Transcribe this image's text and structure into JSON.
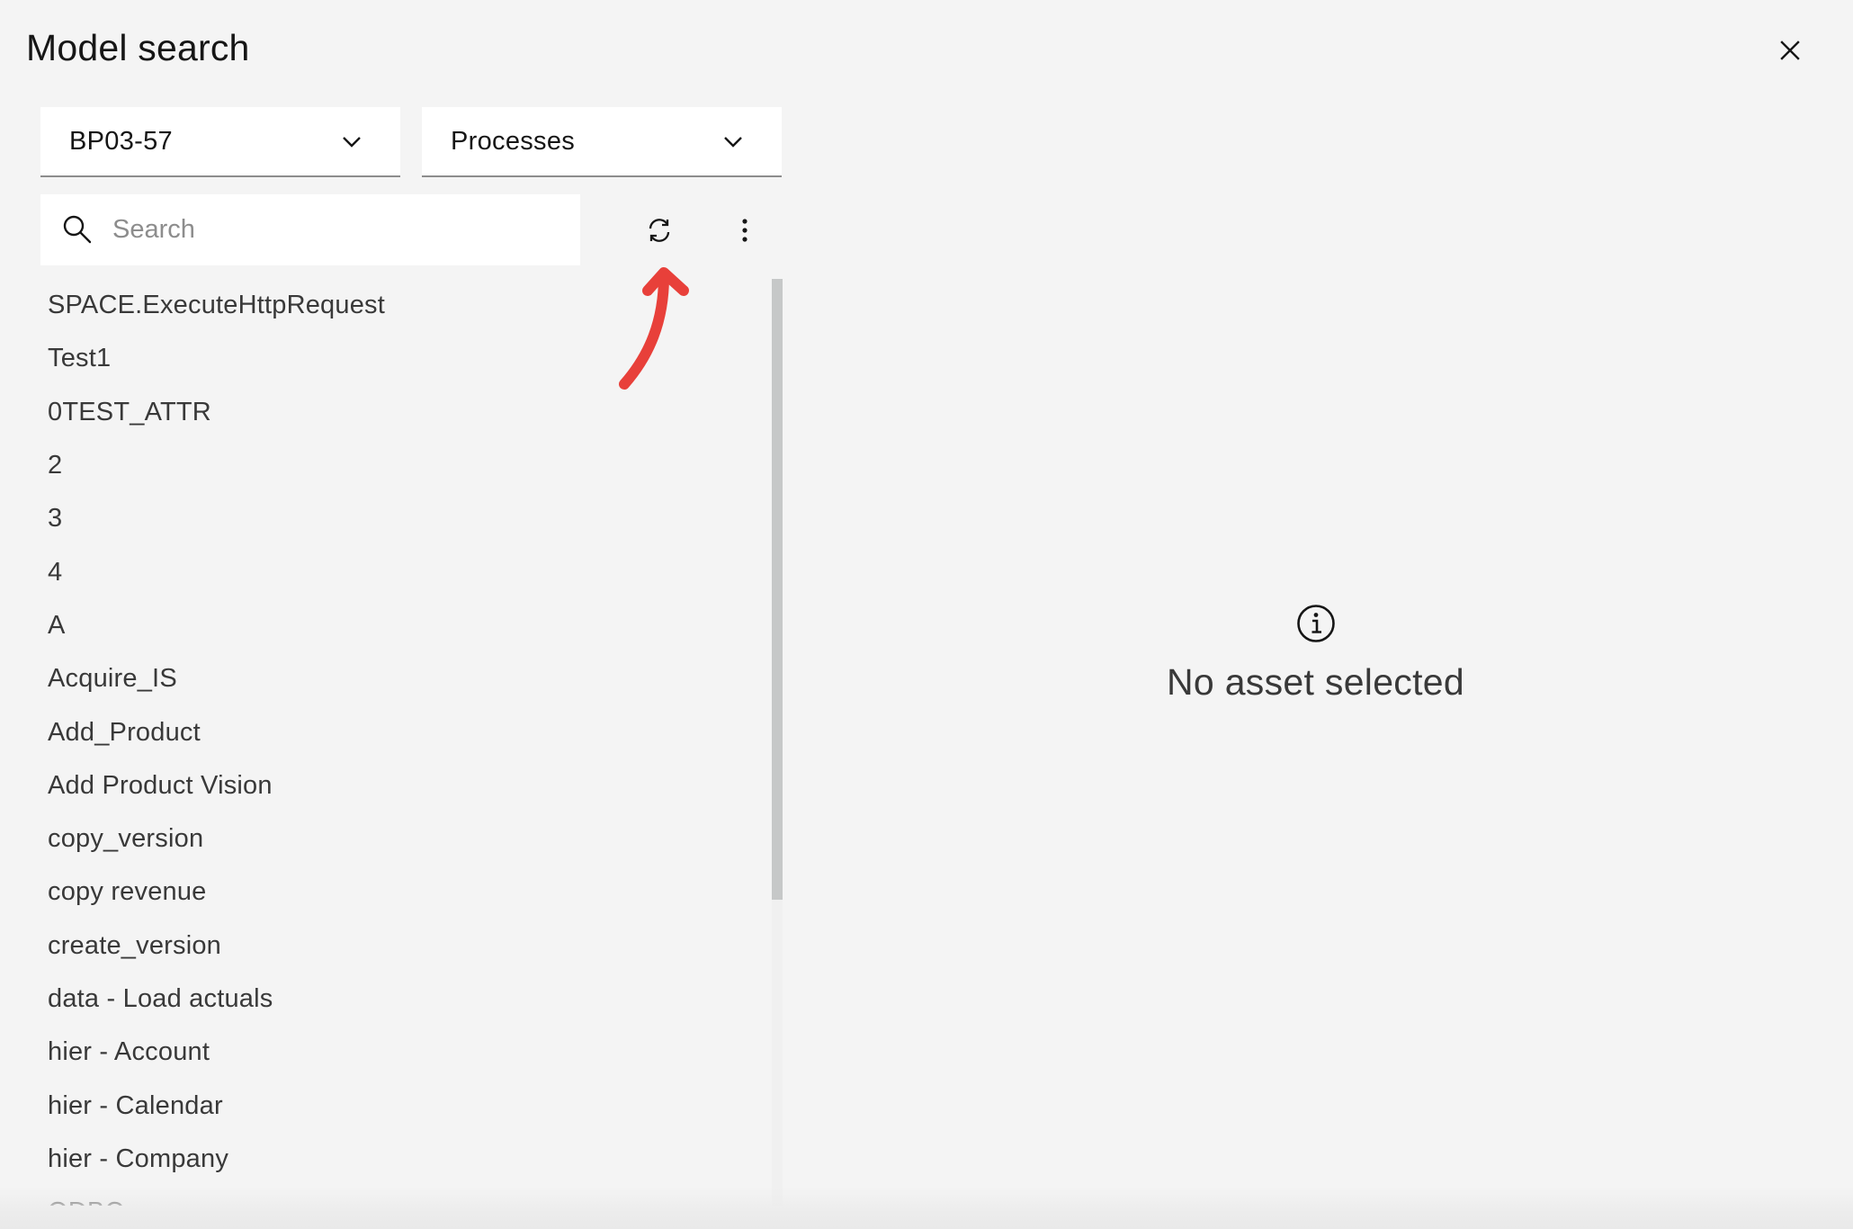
{
  "modal": {
    "title": "Model search",
    "close_icon": "close-icon"
  },
  "filters": {
    "model_dropdown": {
      "selected": "BP03-57",
      "icon": "chevron-down-icon"
    },
    "type_dropdown": {
      "selected": "Processes",
      "icon": "chevron-down-icon"
    }
  },
  "search": {
    "placeholder": "Search",
    "value": "",
    "icon": "search-icon"
  },
  "toolbar": {
    "refresh_icon": "refresh-icon",
    "overflow_icon": "overflow-menu-vertical-icon"
  },
  "annotation": {
    "arrow_color": "#e8403a",
    "icon": "annotation-arrow"
  },
  "list": {
    "items": [
      "SPACE.ExecuteHttpRequest",
      "Test1",
      "0TEST_ATTR",
      "2",
      "3",
      "4",
      "A",
      "Acquire_IS",
      "Add_Product",
      "Add Product Vision",
      "copy_version",
      "copy revenue",
      "create_version",
      "data - Load actuals",
      "hier - Account",
      "hier - Calendar",
      "hier - Company",
      "ODBC"
    ]
  },
  "details": {
    "empty_text": "No asset selected",
    "icon": "information-icon"
  }
}
